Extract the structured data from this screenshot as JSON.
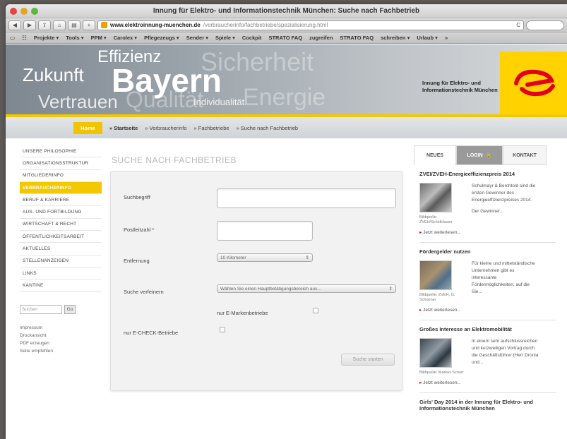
{
  "window": {
    "title": "Innung für Elektro- und Informationstechnik München: Suche nach Fachbetrieb"
  },
  "toolbar": {
    "back": "◀",
    "forward": "▶",
    "url_host": "www.elektroinnung-muenchen.de",
    "url_path": "/verbraucherinfo/fachbetriebe/spezialisierung.html",
    "reload": "C"
  },
  "bookmarks": [
    "Projekte ▾",
    "Tools ▾",
    "PPM ▾",
    "Carolex ▾",
    "Pflegezeugs ▾",
    "Sender ▾",
    "Spiele ▾",
    "Cockpit",
    "STRATO FAQ",
    "zugreifen",
    "STRATO FAQ",
    "schreiben ▾",
    "Urlaub ▾",
    "»"
  ],
  "banner": {
    "words": {
      "effizienz": "Effizienz",
      "zukunft": "Zukunft",
      "bayern": "Bayern",
      "sicherheit": "Sicherheit",
      "vertrauen": "Vertrauen",
      "qualitaet": "Qualität",
      "individual": "Individualität",
      "energie": "Energie"
    },
    "org_line1": "Innung für Elektro- und",
    "org_line2": "Informationstechnik München",
    "accent_color": "#f2c800"
  },
  "nav": {
    "items": [
      "Home",
      "» Startseite",
      "» Verbraucherinfo",
      "» Fachbetriebe",
      "» Suche nach Fachbetrieb"
    ]
  },
  "sidebar": {
    "items": [
      "UNSERE PHILOSOPHIE",
      "ORGANISATIONSSTRUKTUR",
      "MITGLIEDERINFO",
      "VERBRAUCHERINFO",
      "BERUF & KARRIERE",
      "AUS- UND FORTBILDUNG",
      "WIRTSCHAFT & RECHT",
      "ÖFFENTLICHKEITSARBEIT",
      "AKTUELLES",
      "STELLENANZEIGEN",
      "LINKS",
      "KANTINE"
    ],
    "active_index": 3,
    "search_placeholder": "Suchen",
    "search_button": "Go",
    "links": [
      "Impressum",
      "Druckansicht",
      "PDF erzeugen",
      "Seite empfehlen"
    ]
  },
  "main": {
    "title": "SUCHE NACH FACHBETRIEB",
    "labels": {
      "suchbegriff": "Suchbegriff",
      "postleitzahl": "Postleitzahl *",
      "entfernung": "Entfernung",
      "suche_verfeinern": "Suche verfeinern",
      "emarken": "nur E-Markenbetriebe",
      "echeck": "nur E-CHECK-Betriebe"
    },
    "entfernung_value": "10 Kilometer",
    "verfeinern_value": "Wählen Sie einen Hauptbetätigungsbereich aus...",
    "submit": "Suche starten"
  },
  "right": {
    "tabs": [
      "NEUES",
      "LOGIN",
      "KONTAKT"
    ],
    "news": [
      {
        "title": "ZVEI/ZVEH-Energieeffizienzpreis 2014",
        "caption": "Bildquelle: ZVEH/Schölkhauer",
        "text": "Schulmayr & Berchtold sind die ersten Gewinner des Energieeffizienzpreises 2014.",
        "text2": "Der Gewinner...",
        "more": "Jetzt weiterlesen..."
      },
      {
        "title": "Fördergelder nutzen",
        "caption": "Bildquelle: ZVEH, G. Schoener",
        "text": "Für kleine und mittelständische Unternehmen gibt es interessante Fördermöglichkeiten, auf die Sie...",
        "text2": "",
        "more": "Jetzt weiterlesen..."
      },
      {
        "title": "Großes Interesse an Elektromobilität",
        "caption": "Bildquelle: Markus Schurr",
        "text": "In einem sehr aufschlussreichen und kurzweiligen Vortrag durch die Geschäftsführer (Herr Dronia und...",
        "text2": "",
        "more": "Jetzt weiterlesen..."
      }
    ],
    "bottom_title": "Girls' Day 2014 in der Innung für Elektro- und Informationstechnik München"
  }
}
